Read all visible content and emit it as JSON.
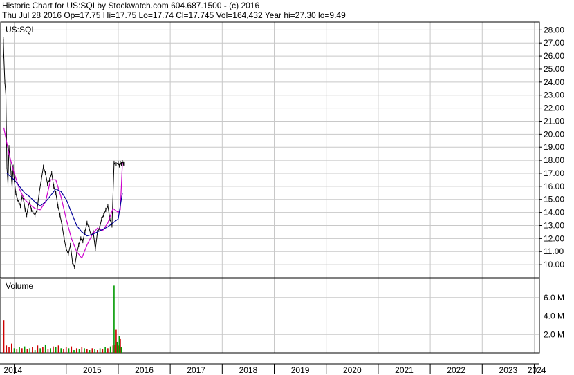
{
  "header": {
    "title": "Historic Chart for US:SQI by Stockwatch.com 604.687.1500 - (c) 2016",
    "quote": "Thu Jul 28 2016   Op=17.75   Hi=17.75   Lo=17.74   Cl=17.745   Vol=164,432   Year hi=27.30   lo=9.49"
  },
  "chart_data": {
    "type": "line",
    "symbol_label": "US:SQI",
    "volume_label": "Volume",
    "x_labels": [
      "2014",
      "2015",
      "2016",
      "2017",
      "2018",
      "2019",
      "2020",
      "2021",
      "2022",
      "2023",
      "2024"
    ],
    "price_axis": {
      "ylim": [
        9.0,
        28.6
      ],
      "ticks": [
        "10.00",
        "11.00",
        "12.00",
        "13.00",
        "14.00",
        "15.00",
        "16.00",
        "17.00",
        "18.00",
        "19.00",
        "20.00",
        "21.00",
        "22.00",
        "23.00",
        "24.00",
        "25.00",
        "26.00",
        "27.00",
        "28.00"
      ]
    },
    "volume_axis": {
      "ylim": [
        0,
        8.0
      ],
      "ticks": [
        "2.0 M",
        "4.0 M",
        "6.0 M"
      ]
    },
    "series": [
      {
        "kind": "price",
        "color": "#000000",
        "x": [
          2013.79,
          2013.8,
          2013.82,
          2013.84,
          2013.86,
          2013.88,
          2013.9,
          2013.92,
          2013.94,
          2013.96,
          2013.98,
          2014.0,
          2014.03,
          2014.06,
          2014.09,
          2014.12,
          2014.15,
          2014.18,
          2014.21,
          2014.24,
          2014.27,
          2014.3,
          2014.33,
          2014.36,
          2014.4,
          2014.44,
          2014.48,
          2014.52,
          2014.56,
          2014.6,
          2014.64,
          2014.68,
          2014.72,
          2014.76,
          2014.8,
          2014.84,
          2014.88,
          2014.92,
          2014.96,
          2015.0,
          2015.04,
          2015.08,
          2015.12,
          2015.16,
          2015.2,
          2015.24,
          2015.28,
          2015.32,
          2015.36,
          2015.4,
          2015.44,
          2015.48,
          2015.52,
          2015.56,
          2015.6,
          2015.64,
          2015.68,
          2015.72,
          2015.76,
          2015.8,
          2015.84,
          2015.88,
          2015.92,
          2015.96,
          2016.0,
          2016.02,
          2016.04,
          2016.06,
          2016.08,
          2016.1,
          2016.12
        ],
        "y": [
          27.3,
          26.0,
          24.0,
          23.0,
          17.5,
          16.2,
          19.0,
          18.0,
          17.0,
          16.0,
          17.5,
          16.5,
          15.5,
          15.0,
          14.8,
          14.5,
          15.2,
          15.0,
          14.2,
          13.8,
          14.5,
          14.8,
          14.2,
          14.0,
          13.8,
          14.2,
          15.5,
          16.5,
          17.5,
          17.0,
          16.2,
          16.5,
          17.0,
          16.0,
          15.5,
          14.5,
          13.8,
          13.0,
          12.0,
          11.2,
          10.8,
          11.5,
          10.2,
          9.8,
          10.8,
          11.5,
          12.0,
          11.8,
          12.5,
          13.2,
          12.8,
          12.2,
          12.5,
          11.2,
          12.5,
          12.8,
          13.5,
          13.8,
          14.2,
          14.5,
          13.5,
          13.0,
          17.8,
          17.7,
          17.8,
          17.6,
          17.8,
          17.7,
          17.9,
          17.75,
          17.745
        ]
      },
      {
        "kind": "moving-average-short",
        "color": "#cc00cc",
        "x": [
          2013.8,
          2013.9,
          2014.0,
          2014.1,
          2014.2,
          2014.3,
          2014.4,
          2014.5,
          2014.6,
          2014.7,
          2014.8,
          2014.9,
          2015.0,
          2015.1,
          2015.2,
          2015.3,
          2015.4,
          2015.5,
          2015.6,
          2015.7,
          2015.8,
          2015.9,
          2016.0,
          2016.04,
          2016.08
        ],
        "y": [
          20.5,
          18.5,
          17.0,
          15.8,
          15.0,
          14.6,
          14.3,
          14.2,
          14.8,
          16.5,
          16.5,
          15.2,
          13.5,
          12.0,
          11.0,
          10.5,
          11.5,
          12.3,
          12.8,
          12.6,
          13.2,
          14.3,
          14.0,
          14.2,
          17.8
        ]
      },
      {
        "kind": "moving-average-long",
        "color": "#000099",
        "x": [
          2013.86,
          2014.0,
          2014.1,
          2014.2,
          2014.3,
          2014.4,
          2014.5,
          2014.6,
          2014.7,
          2014.8,
          2014.9,
          2015.0,
          2015.1,
          2015.2,
          2015.3,
          2015.4,
          2015.5,
          2015.6,
          2015.7,
          2015.8,
          2015.9,
          2016.0,
          2016.04,
          2016.08
        ],
        "y": [
          17.0,
          16.5,
          16.0,
          15.5,
          15.2,
          14.8,
          14.5,
          14.8,
          15.3,
          15.8,
          15.6,
          15.0,
          14.0,
          13.0,
          12.5,
          12.2,
          12.3,
          12.5,
          12.7,
          12.9,
          13.2,
          13.5,
          14.5,
          15.5
        ]
      }
    ],
    "volume": {
      "x": [
        2013.8,
        2013.85,
        2013.9,
        2013.95,
        2014.0,
        2014.05,
        2014.1,
        2014.15,
        2014.2,
        2014.25,
        2014.3,
        2014.35,
        2014.4,
        2014.45,
        2014.5,
        2014.55,
        2014.6,
        2014.65,
        2014.7,
        2014.75,
        2014.8,
        2014.85,
        2014.9,
        2014.95,
        2015.0,
        2015.05,
        2015.1,
        2015.15,
        2015.2,
        2015.25,
        2015.3,
        2015.35,
        2015.4,
        2015.45,
        2015.5,
        2015.55,
        2015.6,
        2015.65,
        2015.7,
        2015.75,
        2015.8,
        2015.85,
        2015.9,
        2015.92,
        2015.94,
        2015.96,
        2015.98,
        2016.0,
        2016.02,
        2016.04,
        2016.06
      ],
      "values": [
        3.5,
        0.8,
        0.6,
        1.0,
        0.5,
        0.4,
        0.6,
        0.5,
        0.7,
        0.4,
        0.5,
        0.6,
        0.3,
        0.8,
        0.5,
        0.6,
        0.9,
        0.4,
        0.5,
        0.7,
        0.6,
        0.8,
        0.5,
        0.4,
        0.6,
        0.5,
        0.7,
        0.3,
        0.5,
        0.4,
        0.6,
        0.5,
        0.4,
        0.3,
        0.5,
        0.4,
        0.3,
        0.5,
        0.4,
        0.6,
        0.5,
        0.7,
        0.8,
        7.3,
        0.9,
        2.5,
        1.2,
        0.8,
        1.8,
        1.5,
        0.6
      ],
      "colors": [
        "#cc0000",
        "#cc0000",
        "#cc0000",
        "#cc0000",
        "#009900",
        "#cc0000",
        "#009900",
        "#cc0000",
        "#009900",
        "#cc0000",
        "#009900",
        "#cc0000",
        "#009900",
        "#cc0000",
        "#009900",
        "#cc0000",
        "#009900",
        "#cc0000",
        "#009900",
        "#cc0000",
        "#009900",
        "#cc0000",
        "#009900",
        "#cc0000",
        "#cc0000",
        "#009900",
        "#cc0000",
        "#009900",
        "#cc0000",
        "#009900",
        "#cc0000",
        "#009900",
        "#cc0000",
        "#009900",
        "#cc0000",
        "#009900",
        "#cc0000",
        "#009900",
        "#cc0000",
        "#009900",
        "#cc0000",
        "#009900",
        "#cc0000",
        "#009900",
        "#cc0000",
        "#cc0000",
        "#009900",
        "#cc0000",
        "#009900",
        "#cc0000",
        "#009900"
      ]
    }
  }
}
